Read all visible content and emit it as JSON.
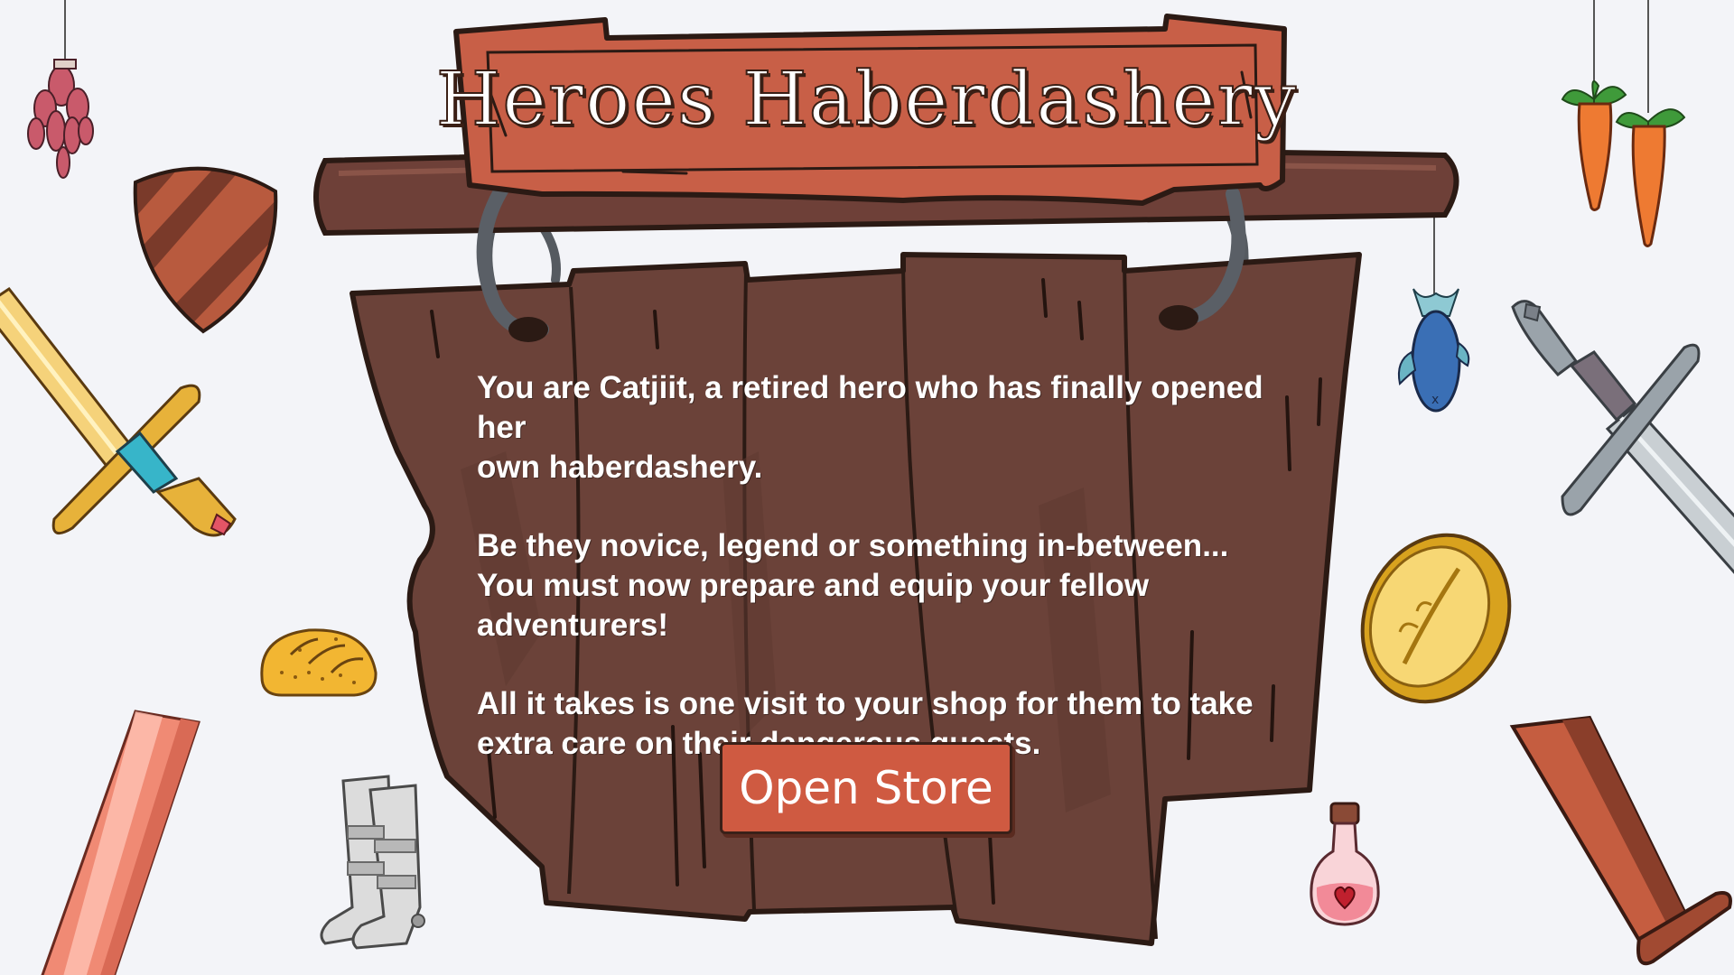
{
  "title": "Heroes Haberdashery",
  "story": {
    "paragraph_1": "You are Catjiit, a retired hero who has finally opened her\nown haberdashery.",
    "paragraph_2": "Be they novice, legend or something in-between...\nYou must now prepare and equip your fellow adventurers!",
    "paragraph_3": "All it takes is one visit to your shop for them to take\nextra care on their dangerous quests."
  },
  "actions": {
    "open_store_label": "Open Store"
  },
  "colors": {
    "background": "#f3f4f8",
    "board_wood": "#6b4239",
    "banner_red": "#c85f47",
    "button_red": "#cf5a41",
    "outline": "#2b1a14"
  },
  "icons": [
    "dried-herbs-icon",
    "shield-icon",
    "golden-sword-icon",
    "bread-icon",
    "crystal-sword-icon",
    "armored-boots-icon",
    "carrots-icon",
    "fish-icon",
    "steel-sword-icon",
    "gold-coin-icon",
    "health-potion-icon",
    "wooden-sword-icon"
  ]
}
